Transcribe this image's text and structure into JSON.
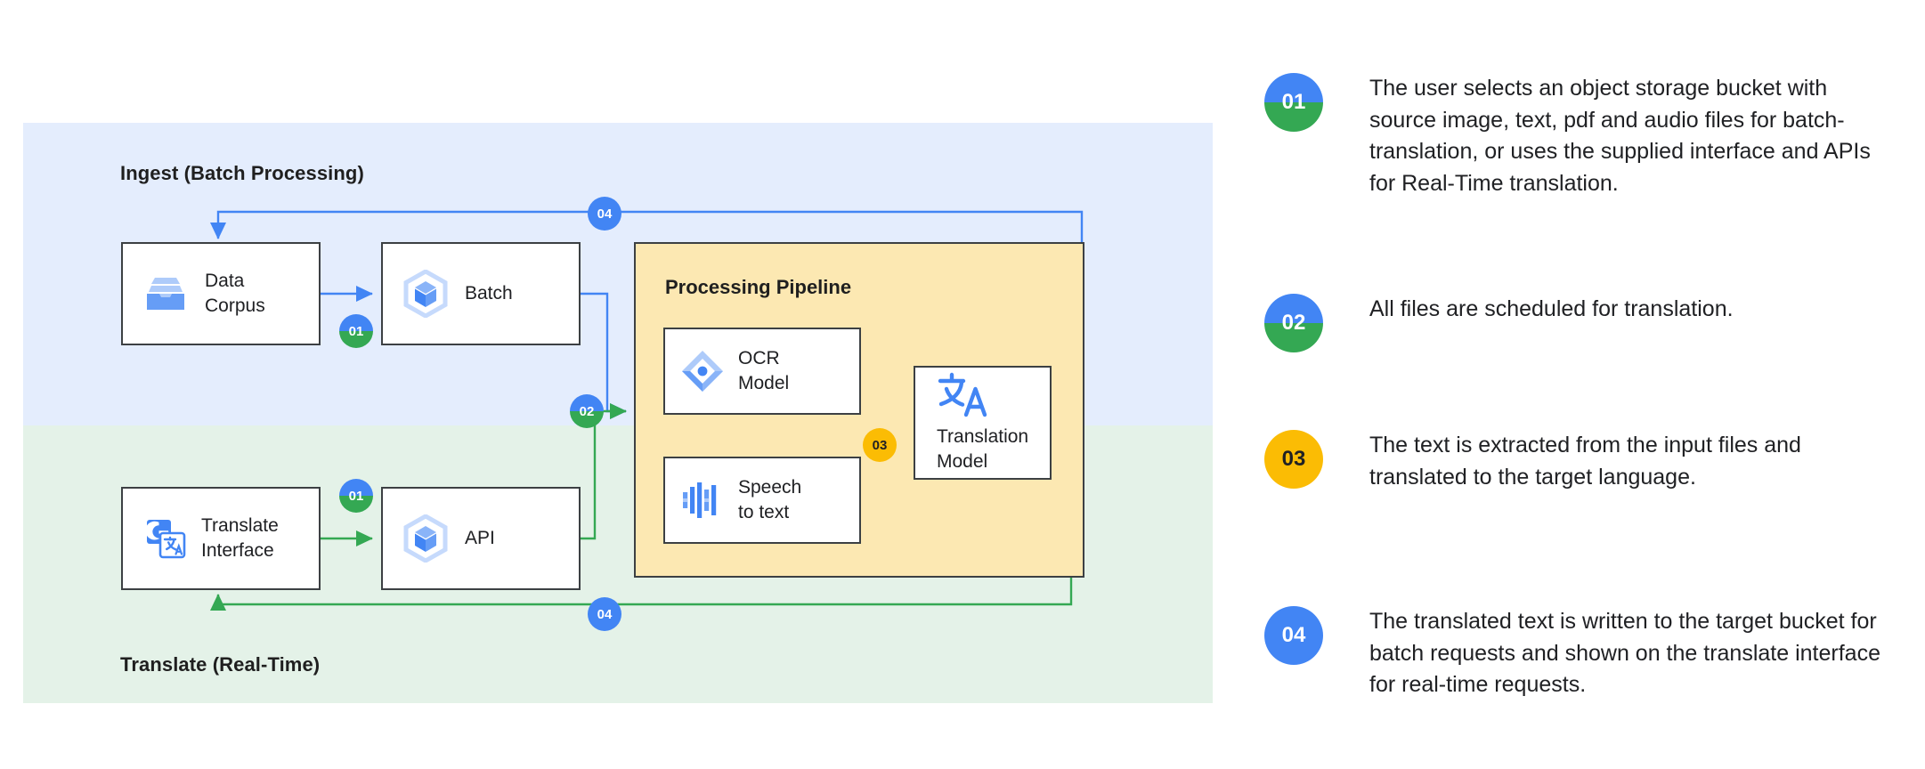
{
  "diagram": {
    "bands": [
      {
        "id": "ingest",
        "label": "Ingest (Batch Processing)",
        "color": "#e4edfd"
      },
      {
        "id": "translate",
        "label": "Translate (Real-Time)",
        "color": "#e4f2e8"
      }
    ],
    "nodes": [
      {
        "id": "data-corpus",
        "label": "Data\nCorpus",
        "icon": "data-corpus-icon"
      },
      {
        "id": "batch",
        "label": "Batch",
        "icon": "batch-cube-icon"
      },
      {
        "id": "translate-interface",
        "label": "Translate\nInterface",
        "icon": "google-translate-icon"
      },
      {
        "id": "api",
        "label": "API",
        "icon": "api-cube-icon"
      },
      {
        "id": "ocr-model",
        "label": "OCR\nModel",
        "icon": "ocr-diamond-icon"
      },
      {
        "id": "speech-to-text",
        "label": "Speech\nto text",
        "icon": "speech-waveform-icon"
      },
      {
        "id": "translation-model",
        "label": "Translation\nModel",
        "icon": "translate-glyph-icon"
      }
    ],
    "group": {
      "id": "processing-pipeline",
      "title": "Processing Pipeline",
      "color": "#fce8b2"
    },
    "step_badges": [
      {
        "id": "d-01a",
        "label": "01",
        "style": "split"
      },
      {
        "id": "d-01b",
        "label": "01",
        "style": "split"
      },
      {
        "id": "d-02",
        "label": "02",
        "style": "split"
      },
      {
        "id": "d-03",
        "label": "03",
        "style": "yellow"
      },
      {
        "id": "d-04a",
        "label": "04",
        "style": "blue"
      },
      {
        "id": "d-04b",
        "label": "04",
        "style": "blue"
      }
    ]
  },
  "legend": {
    "items": [
      {
        "number": "01",
        "style": "split",
        "text": "The user selects an object storage bucket with source image, text, pdf and audio files for batch-translation, or uses the supplied interface and APIs for Real-Time translation."
      },
      {
        "number": "02",
        "style": "split",
        "text": "All files are scheduled for translation."
      },
      {
        "number": "03",
        "style": "yellow",
        "text": "The text is extracted from the input files and translated to the target language."
      },
      {
        "number": "04",
        "style": "blue",
        "text": "The translated text is written to the target bucket for batch requests and shown on the translate interface for real-time requests."
      }
    ]
  },
  "colors": {
    "blue": "#4285f4",
    "green": "#34a853",
    "yellow": "#fbbc04",
    "band_ingest": "#e4edfd",
    "band_translate": "#e4f2e8",
    "pipeline": "#fce8b2",
    "outline": "#3c4043"
  }
}
